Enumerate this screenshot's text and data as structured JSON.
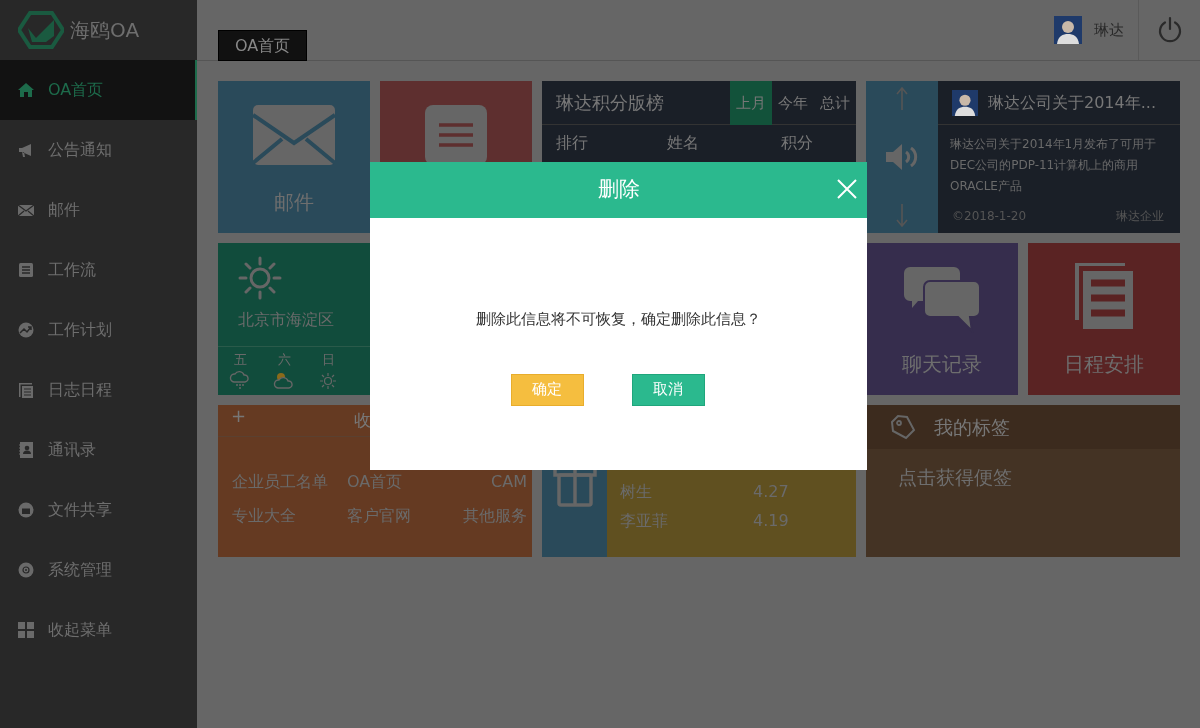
{
  "logo": {
    "text": "海鸥OA"
  },
  "sidebar": {
    "items": [
      {
        "label": "OA首页",
        "selected": true
      },
      {
        "label": "公告通知",
        "selected": false
      },
      {
        "label": "邮件",
        "selected": false
      },
      {
        "label": "工作流",
        "selected": false
      },
      {
        "label": "工作计划",
        "selected": false
      },
      {
        "label": "日志日程",
        "selected": false
      },
      {
        "label": "通讯录",
        "selected": false
      },
      {
        "label": "文件共享",
        "selected": false
      },
      {
        "label": "系统管理",
        "selected": false
      },
      {
        "label": "收起菜单",
        "selected": false
      }
    ]
  },
  "header": {
    "tabs": [
      {
        "label": "OA首页",
        "selected": true
      }
    ],
    "user": {
      "name": "琳达"
    }
  },
  "mail_tile": {
    "label": "邮件"
  },
  "ranking": {
    "title": "琳达积分版榜",
    "tabs": [
      {
        "label": "上月",
        "selected": true
      },
      {
        "label": "今年",
        "selected": false
      },
      {
        "label": "总计",
        "selected": false
      }
    ],
    "columns": [
      "排行",
      "姓名",
      "积分"
    ]
  },
  "news": {
    "title": "琳达公司关于2014年...",
    "body": "琳达公司关于2014年1月发布了可用于DEC公司的PDP-11计算机上的商用ORACLE产品",
    "date": "©2018-1-20",
    "source": "琳达企业"
  },
  "weather": {
    "location": "北京市海淀区",
    "days": [
      {
        "label": "五"
      },
      {
        "label": "六"
      },
      {
        "label": "日"
      }
    ]
  },
  "chat_tile": {
    "label": "聊天记录"
  },
  "schedule_tile": {
    "label": "日程安排"
  },
  "favorites": {
    "add": "+",
    "title": "收",
    "links": [
      "企业员工名单",
      "OA首页",
      "CAM",
      "专业大全",
      "客户官网",
      "其他服务"
    ]
  },
  "scores": {
    "rows": [
      {
        "name": "树生",
        "score": "4.27"
      },
      {
        "name": "李亚菲",
        "score": "4.19"
      }
    ]
  },
  "tags": {
    "title": "我的标签",
    "hint": "点击获得便签"
  },
  "dialog": {
    "title": "删除",
    "message": "删除此信息将不可恢复，确定删除此信息？",
    "buttons": [
      {
        "label": "确定",
        "kind": "confirm"
      },
      {
        "label": "取消",
        "kind": "cancel"
      }
    ]
  }
}
